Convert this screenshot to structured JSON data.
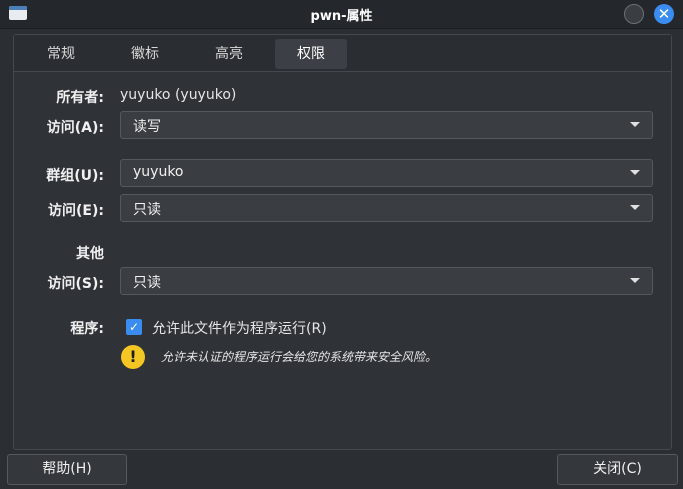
{
  "window": {
    "title": "pwn-属性",
    "close_glyph": "✕"
  },
  "tabs": [
    {
      "label": "常规"
    },
    {
      "label": "徽标"
    },
    {
      "label": "高亮"
    },
    {
      "label": "权限",
      "active": true
    }
  ],
  "owner": {
    "label": "所有者:",
    "value": "yuyuko (yuyuko)",
    "access_label": "访问(A):",
    "access_value": "读写"
  },
  "group": {
    "label": "群组(U):",
    "value": "yuyuko",
    "access_label": "访问(E):",
    "access_value": "只读"
  },
  "others": {
    "label": "其他",
    "access_label": "访问(S):",
    "access_value": "只读"
  },
  "program": {
    "label": "程序:",
    "checkbox_label": "允许此文件作为程序运行(R)",
    "checked": true,
    "warning": "允许未认证的程序运行会给您的系统带来安全风险。"
  },
  "buttons": {
    "help": "帮助(H)",
    "close": "关闭(C)"
  },
  "icons": {
    "app": "folder-window-icon",
    "minimize": "minimize-icon",
    "close": "close-icon",
    "dropdown": "chevron-down-icon",
    "check": "checkmark-icon",
    "warning": "warning-icon"
  },
  "colors": {
    "accent": "#3b8cf0",
    "warning": "#f3c623",
    "background": "#2b2e33"
  }
}
